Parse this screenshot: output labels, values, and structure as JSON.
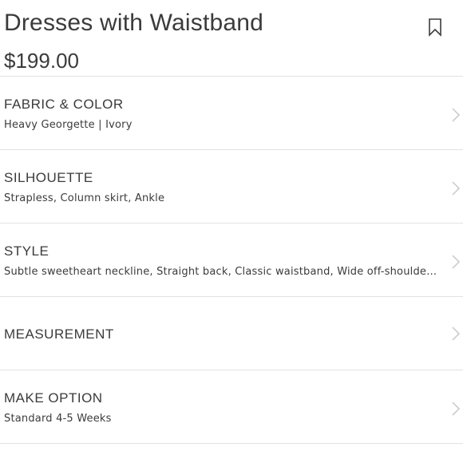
{
  "product": {
    "title": "Dresses with Waistband",
    "price": "$199.00",
    "bookmark_icon": "bookmark-icon"
  },
  "options": [
    {
      "label": "FABRIC & COLOR",
      "value": "Heavy Georgette | Ivory"
    },
    {
      "label": "SILHOUETTE",
      "value": "Strapless, Column skirt, Ankle"
    },
    {
      "label": "STYLE",
      "value": "Subtle sweetheart neckline, Straight back, Classic waistband, Wide off-shoulder pa..."
    },
    {
      "label": "MEASUREMENT",
      "value": ""
    },
    {
      "label": "MAKE OPTION",
      "value": "Standard 4-5 Weeks"
    }
  ],
  "colors": {
    "text": "#3b3b3b",
    "divider": "#e2e2e2",
    "chevron": "#c8c8c8"
  }
}
